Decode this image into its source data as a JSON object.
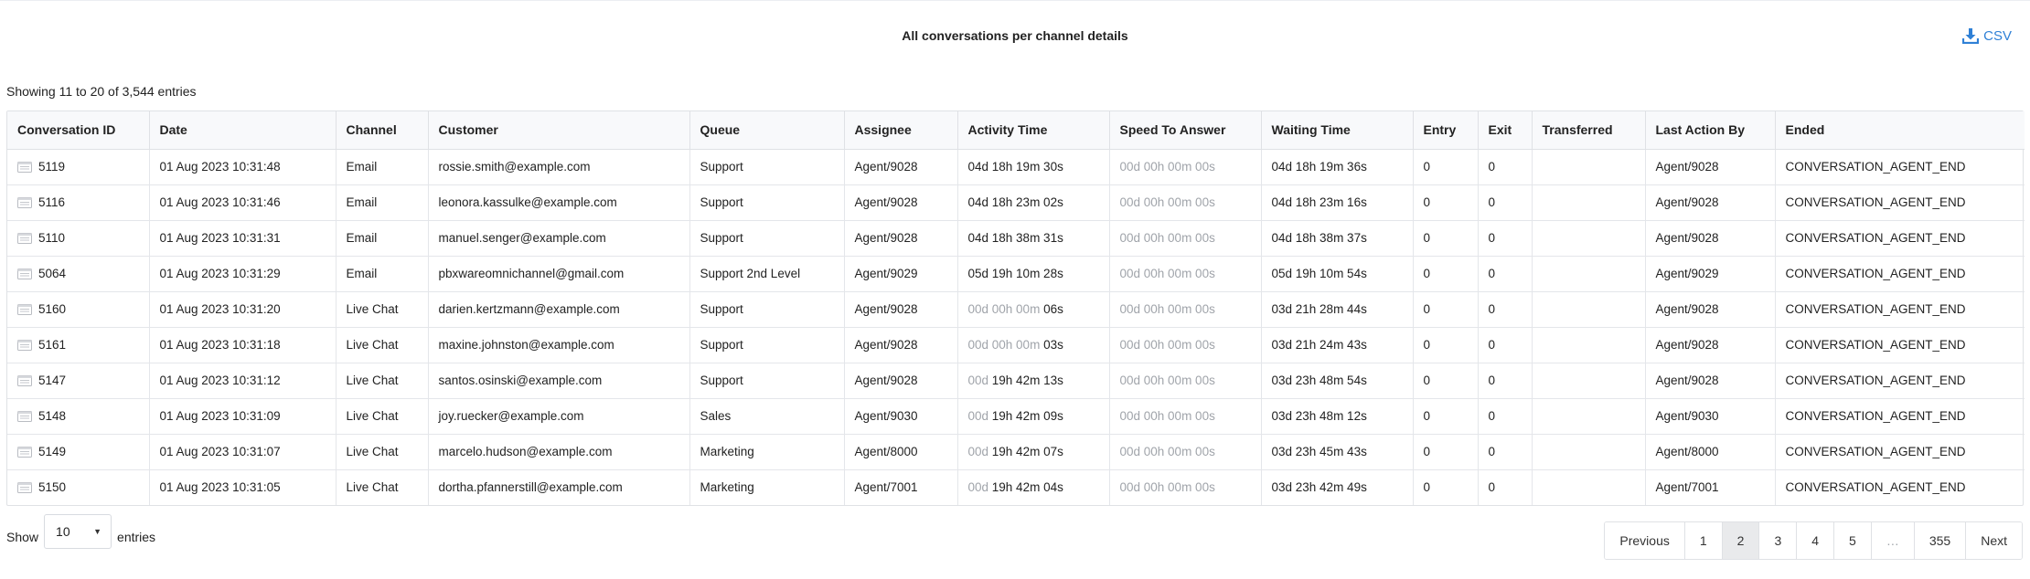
{
  "report": {
    "title": "All conversations per channel details",
    "export_label": "CSV",
    "showing_text": "Showing 11 to 20 of 3,544 entries"
  },
  "table": {
    "columns": [
      "Conversation ID",
      "Date",
      "Channel",
      "Customer",
      "Queue",
      "Assignee",
      "Activity Time",
      "Speed To Answer",
      "Waiting Time",
      "Entry",
      "Exit",
      "Transferred",
      "Last Action By",
      "Ended"
    ],
    "rows": [
      {
        "id": "5119",
        "date": "01 Aug 2023 10:31:48",
        "channel": "Email",
        "customer": "rossie.smith@example.com",
        "queue": "Support",
        "assignee": "Agent/9028",
        "activity_muted": "",
        "activity": "04d 18h 19m 30s",
        "speed": "00d 00h 00m 00s",
        "waiting": "04d 18h 19m 36s",
        "entry": "0",
        "exit": "0",
        "transferred": "",
        "last_action_by": "Agent/9028",
        "ended": "CONVERSATION_AGENT_END"
      },
      {
        "id": "5116",
        "date": "01 Aug 2023 10:31:46",
        "channel": "Email",
        "customer": "leonora.kassulke@example.com",
        "queue": "Support",
        "assignee": "Agent/9028",
        "activity_muted": "",
        "activity": "04d 18h 23m 02s",
        "speed": "00d 00h 00m 00s",
        "waiting": "04d 18h 23m 16s",
        "entry": "0",
        "exit": "0",
        "transferred": "",
        "last_action_by": "Agent/9028",
        "ended": "CONVERSATION_AGENT_END"
      },
      {
        "id": "5110",
        "date": "01 Aug 2023 10:31:31",
        "channel": "Email",
        "customer": "manuel.senger@example.com",
        "queue": "Support",
        "assignee": "Agent/9028",
        "activity_muted": "",
        "activity": "04d 18h 38m 31s",
        "speed": "00d 00h 00m 00s",
        "waiting": "04d 18h 38m 37s",
        "entry": "0",
        "exit": "0",
        "transferred": "",
        "last_action_by": "Agent/9028",
        "ended": "CONVERSATION_AGENT_END"
      },
      {
        "id": "5064",
        "date": "01 Aug 2023 10:31:29",
        "channel": "Email",
        "customer": "pbxwareomnichannel@gmail.com",
        "queue": "Support 2nd Level",
        "assignee": "Agent/9029",
        "activity_muted": "",
        "activity": "05d 19h 10m 28s",
        "speed": "00d 00h 00m 00s",
        "waiting": "05d 19h 10m 54s",
        "entry": "0",
        "exit": "0",
        "transferred": "",
        "last_action_by": "Agent/9029",
        "ended": "CONVERSATION_AGENT_END"
      },
      {
        "id": "5160",
        "date": "01 Aug 2023 10:31:20",
        "channel": "Live Chat",
        "customer": "darien.kertzmann@example.com",
        "queue": "Support",
        "assignee": "Agent/9028",
        "activity_muted": "00d 00h 00m ",
        "activity": "06s",
        "speed": "00d 00h 00m 00s",
        "waiting": "03d 21h 28m 44s",
        "entry": "0",
        "exit": "0",
        "transferred": "",
        "last_action_by": "Agent/9028",
        "ended": "CONVERSATION_AGENT_END"
      },
      {
        "id": "5161",
        "date": "01 Aug 2023 10:31:18",
        "channel": "Live Chat",
        "customer": "maxine.johnston@example.com",
        "queue": "Support",
        "assignee": "Agent/9028",
        "activity_muted": "00d 00h 00m ",
        "activity": "03s",
        "speed": "00d 00h 00m 00s",
        "waiting": "03d 21h 24m 43s",
        "entry": "0",
        "exit": "0",
        "transferred": "",
        "last_action_by": "Agent/9028",
        "ended": "CONVERSATION_AGENT_END"
      },
      {
        "id": "5147",
        "date": "01 Aug 2023 10:31:12",
        "channel": "Live Chat",
        "customer": "santos.osinski@example.com",
        "queue": "Support",
        "assignee": "Agent/9028",
        "activity_muted": "00d ",
        "activity": "19h 42m 13s",
        "speed": "00d 00h 00m 00s",
        "waiting": "03d 23h 48m 54s",
        "entry": "0",
        "exit": "0",
        "transferred": "",
        "last_action_by": "Agent/9028",
        "ended": "CONVERSATION_AGENT_END"
      },
      {
        "id": "5148",
        "date": "01 Aug 2023 10:31:09",
        "channel": "Live Chat",
        "customer": "joy.ruecker@example.com",
        "queue": "Sales",
        "assignee": "Agent/9030",
        "activity_muted": "00d ",
        "activity": "19h 42m 09s",
        "speed": "00d 00h 00m 00s",
        "waiting": "03d 23h 48m 12s",
        "entry": "0",
        "exit": "0",
        "transferred": "",
        "last_action_by": "Agent/9030",
        "ended": "CONVERSATION_AGENT_END"
      },
      {
        "id": "5149",
        "date": "01 Aug 2023 10:31:07",
        "channel": "Live Chat",
        "customer": "marcelo.hudson@example.com",
        "queue": "Marketing",
        "assignee": "Agent/8000",
        "activity_muted": "00d ",
        "activity": "19h 42m 07s",
        "speed": "00d 00h 00m 00s",
        "waiting": "03d 23h 45m 43s",
        "entry": "0",
        "exit": "0",
        "transferred": "",
        "last_action_by": "Agent/8000",
        "ended": "CONVERSATION_AGENT_END"
      },
      {
        "id": "5150",
        "date": "01 Aug 2023 10:31:05",
        "channel": "Live Chat",
        "customer": "dortha.pfannerstill@example.com",
        "queue": "Marketing",
        "assignee": "Agent/7001",
        "activity_muted": "00d ",
        "activity": "19h 42m 04s",
        "speed": "00d 00h 00m 00s",
        "waiting": "03d 23h 42m 49s",
        "entry": "0",
        "exit": "0",
        "transferred": "",
        "last_action_by": "Agent/7001",
        "ended": "CONVERSATION_AGENT_END"
      }
    ]
  },
  "length_menu": {
    "prefix": "Show",
    "selected": "10",
    "suffix": "entries"
  },
  "pagination": {
    "previous": "Previous",
    "pages": [
      "1",
      "2",
      "3",
      "4",
      "5"
    ],
    "active_page": "2",
    "ellipsis": "…",
    "last_page": "355",
    "next": "Next"
  },
  "icons": {
    "export": "download-icon",
    "row": "chat-transcript-icon"
  },
  "colors": {
    "accent": "#2f80d6",
    "muted_text": "#a0a4aa",
    "header_bg": "#f8f9fb",
    "active_page_bg": "#e9eaec"
  }
}
